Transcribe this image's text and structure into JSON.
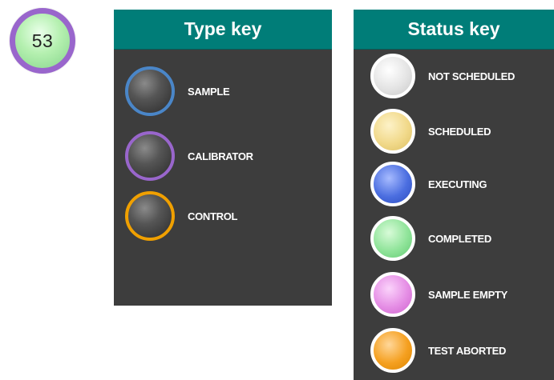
{
  "badge": {
    "number": "53",
    "ring_color": "#9966cc",
    "fill_color": "#b5f0b0"
  },
  "type_key": {
    "title": "Type key",
    "items": [
      {
        "label": "SAMPLE",
        "ring_color": "#4a86c8",
        "icon": "sample-type-circle-icon"
      },
      {
        "label": "CALIBRATOR",
        "ring_color": "#9966cc",
        "icon": "calibrator-type-circle-icon"
      },
      {
        "label": "CONTROL",
        "ring_color": "#f0a000",
        "icon": "control-type-circle-icon"
      }
    ]
  },
  "status_key": {
    "title": "Status key",
    "items": [
      {
        "label": "NOT SCHEDULED",
        "fill_color": "#e4e4e4",
        "icon": "not-scheduled-status-circle-icon"
      },
      {
        "label": "SCHEDULED",
        "fill_color": "#f1d98a",
        "icon": "scheduled-status-circle-icon"
      },
      {
        "label": "EXECUTING",
        "fill_color": "#4b6ee0",
        "icon": "executing-status-circle-icon"
      },
      {
        "label": "COMPLETED",
        "fill_color": "#90e49a",
        "icon": "completed-status-circle-icon"
      },
      {
        "label": "SAMPLE EMPTY",
        "fill_color": "#e58ee5",
        "icon": "sample-empty-status-circle-icon"
      },
      {
        "label": "TEST ABORTED",
        "fill_color": "#f5a020",
        "icon": "test-aborted-status-circle-icon"
      }
    ]
  },
  "colors": {
    "panel_background": "#3d3d3d",
    "header_background": "#007d78",
    "text": "#ffffff"
  }
}
